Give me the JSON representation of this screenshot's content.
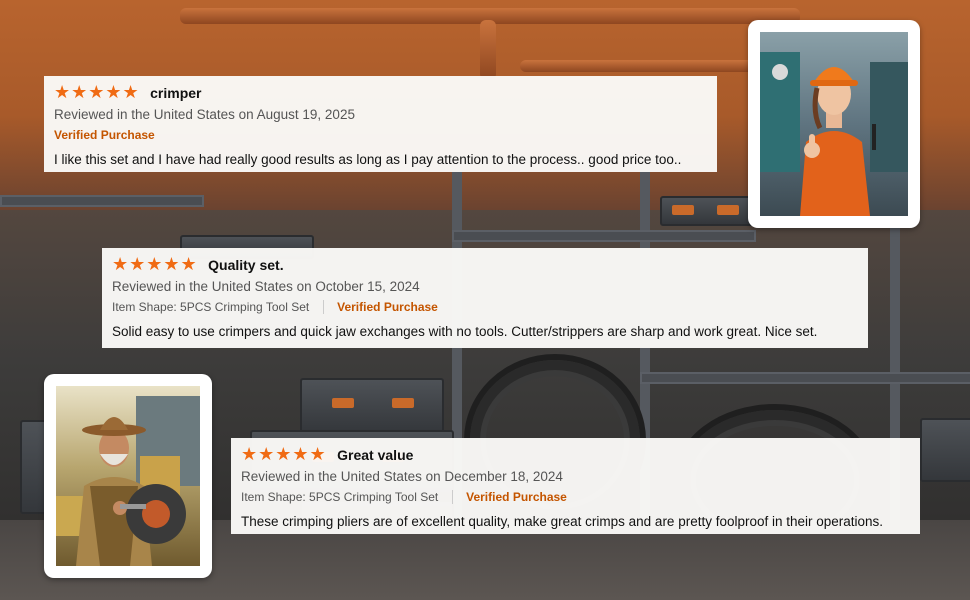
{
  "reviews": [
    {
      "stars": "★★★★★",
      "title": "crimper",
      "meta": "Reviewed in the United States on August 19, 2025",
      "item_shape": "",
      "verified": "Verified Purchase",
      "body": "I like this set and I have had really good results as long as I pay attention to the process.. good price too.."
    },
    {
      "stars": "★★★★★",
      "title": "Quality set.",
      "meta": "Reviewed in the United States on October 15, 2024",
      "item_shape": "Item Shape: 5PCS Crimping Tool Set",
      "verified": "Verified Purchase",
      "body": "Solid easy to use crimpers and quick jaw exchanges with no tools. Cutter/strippers are sharp and work great. Nice set."
    },
    {
      "stars": "★★★★★",
      "title": "Great value",
      "meta": "Reviewed in the United States on December 18, 2024",
      "item_shape": "Item Shape: 5PCS Crimping Tool Set",
      "verified": "Verified Purchase",
      "body": "These crimping pliers are of excellent quality, make great crimps and are pretty foolproof in their operations."
    }
  ],
  "colors": {
    "star": "#f06b14",
    "verified": "#c45500"
  }
}
